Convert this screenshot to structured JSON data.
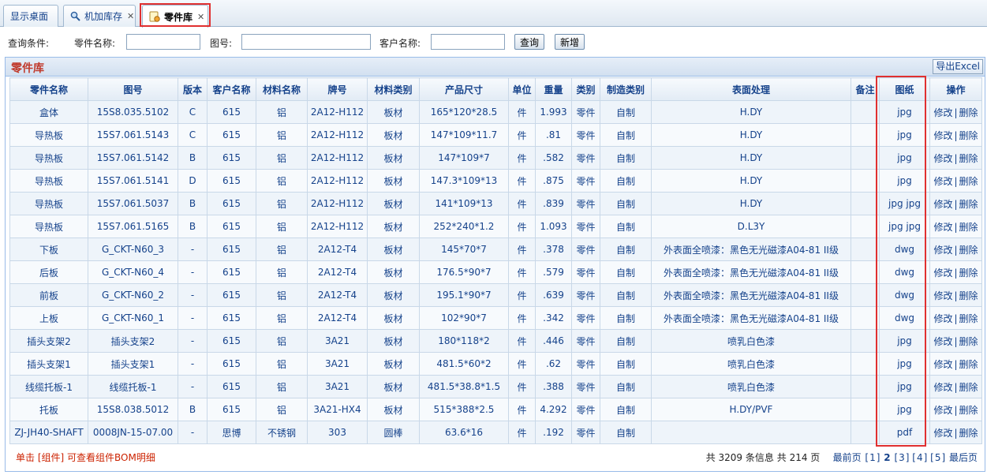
{
  "tabs": [
    {
      "label": "显示桌面",
      "closable": false
    },
    {
      "label": "机加库存",
      "closable": true,
      "icon": "search-icon"
    },
    {
      "label": "零件库",
      "closable": true,
      "icon": "parts-icon",
      "active": true
    }
  ],
  "query": {
    "condition_label": "查询条件:",
    "part_name_label": "零件名称:",
    "part_name_value": "",
    "drawing_no_label": "图号:",
    "drawing_no_value": "",
    "customer_label": "客户名称:",
    "customer_value": "",
    "search_button": "查询",
    "add_button": "新增"
  },
  "panel": {
    "title": "零件库",
    "export_button": "导出Excel"
  },
  "table": {
    "columns": [
      "零件名称",
      "图号",
      "版本",
      "客户名称",
      "材料名称",
      "牌号",
      "材料类别",
      "产品尺寸",
      "单位",
      "重量",
      "类别",
      "制造类别",
      "表面处理",
      "备注",
      "图纸",
      "操作"
    ],
    "edit_label": "修改",
    "delete_label": "删除",
    "rows": [
      {
        "name": "盒体",
        "drawing": "15S8.035.5102",
        "ver": "C",
        "customer": "615",
        "material": "铝",
        "grade": "2A12-H112",
        "mat_type": "板材",
        "size": "165*120*28.5",
        "unit": "件",
        "weight": "1.993",
        "category": "零件",
        "mfg": "自制",
        "surface": "H.DY",
        "note": "",
        "files": "jpg"
      },
      {
        "name": "导热板",
        "drawing": "15S7.061.5143",
        "ver": "C",
        "customer": "615",
        "material": "铝",
        "grade": "2A12-H112",
        "mat_type": "板材",
        "size": "147*109*11.7",
        "unit": "件",
        "weight": ".81",
        "category": "零件",
        "mfg": "自制",
        "surface": "H.DY",
        "note": "",
        "files": "jpg"
      },
      {
        "name": "导热板",
        "drawing": "15S7.061.5142",
        "ver": "B",
        "customer": "615",
        "material": "铝",
        "grade": "2A12-H112",
        "mat_type": "板材",
        "size": "147*109*7",
        "unit": "件",
        "weight": ".582",
        "category": "零件",
        "mfg": "自制",
        "surface": "H.DY",
        "note": "",
        "files": "jpg"
      },
      {
        "name": "导热板",
        "drawing": "15S7.061.5141",
        "ver": "D",
        "customer": "615",
        "material": "铝",
        "grade": "2A12-H112",
        "mat_type": "板材",
        "size": "147.3*109*13",
        "unit": "件",
        "weight": ".875",
        "category": "零件",
        "mfg": "自制",
        "surface": "H.DY",
        "note": "",
        "files": "jpg"
      },
      {
        "name": "导热板",
        "drawing": "15S7.061.5037",
        "ver": "B",
        "customer": "615",
        "material": "铝",
        "grade": "2A12-H112",
        "mat_type": "板材",
        "size": "141*109*13",
        "unit": "件",
        "weight": ".839",
        "category": "零件",
        "mfg": "自制",
        "surface": "H.DY",
        "note": "",
        "files": "jpg jpg"
      },
      {
        "name": "导热板",
        "drawing": "15S7.061.5165",
        "ver": "B",
        "customer": "615",
        "material": "铝",
        "grade": "2A12-H112",
        "mat_type": "板材",
        "size": "252*240*1.2",
        "unit": "件",
        "weight": "1.093",
        "category": "零件",
        "mfg": "自制",
        "surface": "D.L3Y",
        "note": "",
        "files": "jpg jpg"
      },
      {
        "name": "下板",
        "drawing": "G_CKT-N60_3",
        "ver": "-",
        "customer": "615",
        "material": "铝",
        "grade": "2A12-T4",
        "mat_type": "板材",
        "size": "145*70*7",
        "unit": "件",
        "weight": ".378",
        "category": "零件",
        "mfg": "自制",
        "surface": "外表面全喷漆：黑色无光磁漆A04-81 II级",
        "note": "",
        "files": "dwg"
      },
      {
        "name": "后板",
        "drawing": "G_CKT-N60_4",
        "ver": "-",
        "customer": "615",
        "material": "铝",
        "grade": "2A12-T4",
        "mat_type": "板材",
        "size": "176.5*90*7",
        "unit": "件",
        "weight": ".579",
        "category": "零件",
        "mfg": "自制",
        "surface": "外表面全喷漆：黑色无光磁漆A04-81 II级",
        "note": "",
        "files": "dwg"
      },
      {
        "name": "前板",
        "drawing": "G_CKT-N60_2",
        "ver": "-",
        "customer": "615",
        "material": "铝",
        "grade": "2A12-T4",
        "mat_type": "板材",
        "size": "195.1*90*7",
        "unit": "件",
        "weight": ".639",
        "category": "零件",
        "mfg": "自制",
        "surface": "外表面全喷漆：黑色无光磁漆A04-81 II级",
        "note": "",
        "files": "dwg"
      },
      {
        "name": "上板",
        "drawing": "G_CKT-N60_1",
        "ver": "-",
        "customer": "615",
        "material": "铝",
        "grade": "2A12-T4",
        "mat_type": "板材",
        "size": "102*90*7",
        "unit": "件",
        "weight": ".342",
        "category": "零件",
        "mfg": "自制",
        "surface": "外表面全喷漆：黑色无光磁漆A04-81 II级",
        "note": "",
        "files": "dwg"
      },
      {
        "name": "插头支架2",
        "drawing": "插头支架2",
        "ver": "-",
        "customer": "615",
        "material": "铝",
        "grade": "3A21",
        "mat_type": "板材",
        "size": "180*118*2",
        "unit": "件",
        "weight": ".446",
        "category": "零件",
        "mfg": "自制",
        "surface": "喷乳白色漆",
        "note": "",
        "files": "jpg"
      },
      {
        "name": "插头支架1",
        "drawing": "插头支架1",
        "ver": "-",
        "customer": "615",
        "material": "铝",
        "grade": "3A21",
        "mat_type": "板材",
        "size": "481.5*60*2",
        "unit": "件",
        "weight": ".62",
        "category": "零件",
        "mfg": "自制",
        "surface": "喷乳白色漆",
        "note": "",
        "files": "jpg"
      },
      {
        "name": "线缆托板-1",
        "drawing": "线缆托板-1",
        "ver": "-",
        "customer": "615",
        "material": "铝",
        "grade": "3A21",
        "mat_type": "板材",
        "size": "481.5*38.8*1.5",
        "unit": "件",
        "weight": ".388",
        "category": "零件",
        "mfg": "自制",
        "surface": "喷乳白色漆",
        "note": "",
        "files": "jpg"
      },
      {
        "name": "托板",
        "drawing": "15S8.038.5012",
        "ver": "B",
        "customer": "615",
        "material": "铝",
        "grade": "3A21-HX4",
        "mat_type": "板材",
        "size": "515*388*2.5",
        "unit": "件",
        "weight": "4.292",
        "category": "零件",
        "mfg": "自制",
        "surface": "H.DY/PVF",
        "note": "",
        "files": "jpg"
      },
      {
        "name": "ZJ-JH40-SHAFT",
        "drawing": "0008JN-15-07.00",
        "ver": "-",
        "customer": "思博",
        "material": "不锈钢",
        "grade": "303",
        "mat_type": "圆棒",
        "size": "63.6*16",
        "unit": "件",
        "weight": ".192",
        "category": "零件",
        "mfg": "自制",
        "surface": "",
        "note": "",
        "files": "pdf"
      }
    ]
  },
  "footer": {
    "hint": "单击 [组件] 可查看组件BOM明细",
    "total_prefix": "共",
    "total_records": "3209",
    "total_mid": "条信息  共",
    "total_pages": "214",
    "total_suffix": "页",
    "first": "最前页",
    "pages": [
      "1",
      "2",
      "3",
      "4",
      "5"
    ],
    "current_page": "2",
    "last": "最后页"
  },
  "colors": {
    "accent": "#15428b",
    "highlight_border": "#e03030",
    "panel_title": "#c0392b"
  }
}
